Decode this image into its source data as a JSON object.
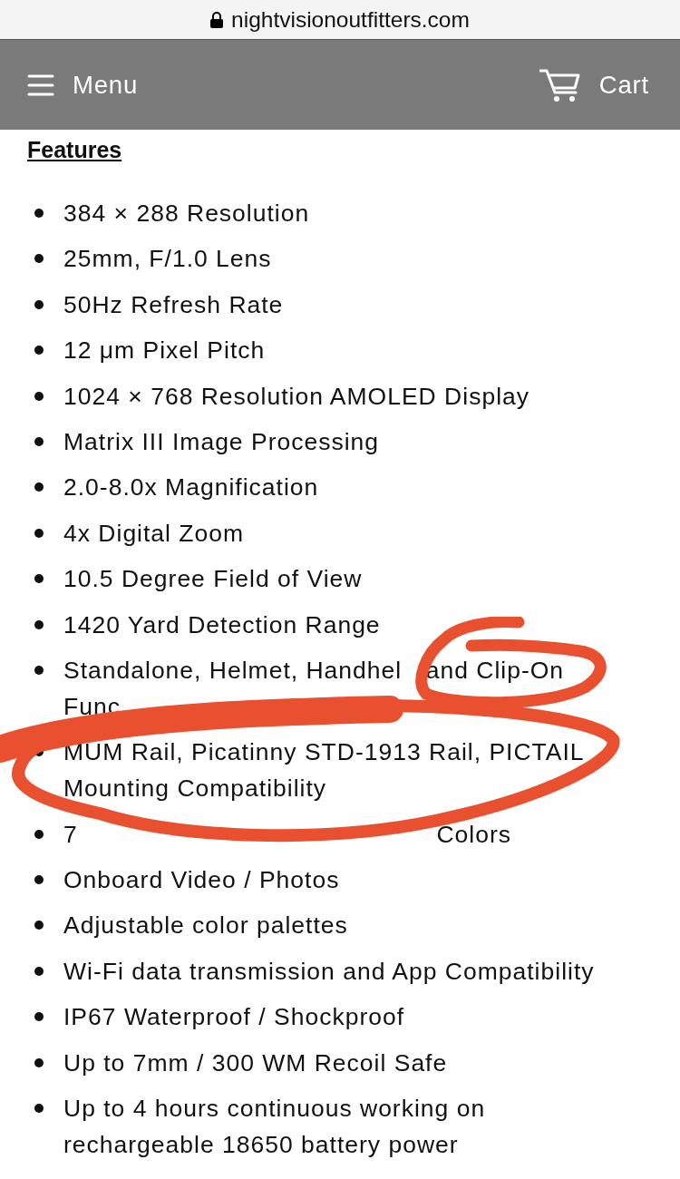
{
  "address_bar": {
    "url": "nightvisionoutfitters.com"
  },
  "header": {
    "menu_label": "Menu",
    "cart_label": "Cart"
  },
  "section": {
    "title": "Features",
    "items": [
      {
        "kind": "text",
        "text": "384 × 288 Resolution"
      },
      {
        "kind": "text",
        "text": "25mm, F/1.0 Lens"
      },
      {
        "kind": "text",
        "text": "50Hz Refresh Rate"
      },
      {
        "kind": "text",
        "text": "12 μm Pixel Pitch"
      },
      {
        "kind": "text",
        "text": "1024 × 768 Resolution AMOLED Display"
      },
      {
        "kind": "text",
        "text": "Matrix III Image Processing"
      },
      {
        "kind": "text",
        "text": "2.0-8.0x Magnification"
      },
      {
        "kind": "text",
        "text": "4x Digital Zoom"
      },
      {
        "kind": "text",
        "text": "10.5 Degree Field of View"
      },
      {
        "kind": "text",
        "text": "1420 Yard Detection Range"
      },
      {
        "kind": "covered",
        "lines": [
          [
            "Standalone, Helmet, Handhel",
            "and Clip-On"
          ],
          [
            "Func"
          ]
        ]
      },
      {
        "kind": "text",
        "text": "MUM Rail, Picatinny STD-1913 Rail, PICTAIL Mounting Compatibility"
      },
      {
        "kind": "covered",
        "lines": [
          [
            "7",
            "Colors"
          ]
        ]
      },
      {
        "kind": "text",
        "text": "Onboard Video / Photos"
      },
      {
        "kind": "text",
        "text": "Adjustable color palettes"
      },
      {
        "kind": "text",
        "text": "Wi-Fi data transmission and App Compatibility"
      },
      {
        "kind": "text",
        "text": "IP67 Waterproof / Shockproof"
      },
      {
        "kind": "text",
        "text": "Up to 7mm / 300 WM Recoil Safe"
      },
      {
        "kind": "text",
        "text": "Up to 4 hours continuous working on rechargeable 18650 battery power"
      }
    ]
  }
}
